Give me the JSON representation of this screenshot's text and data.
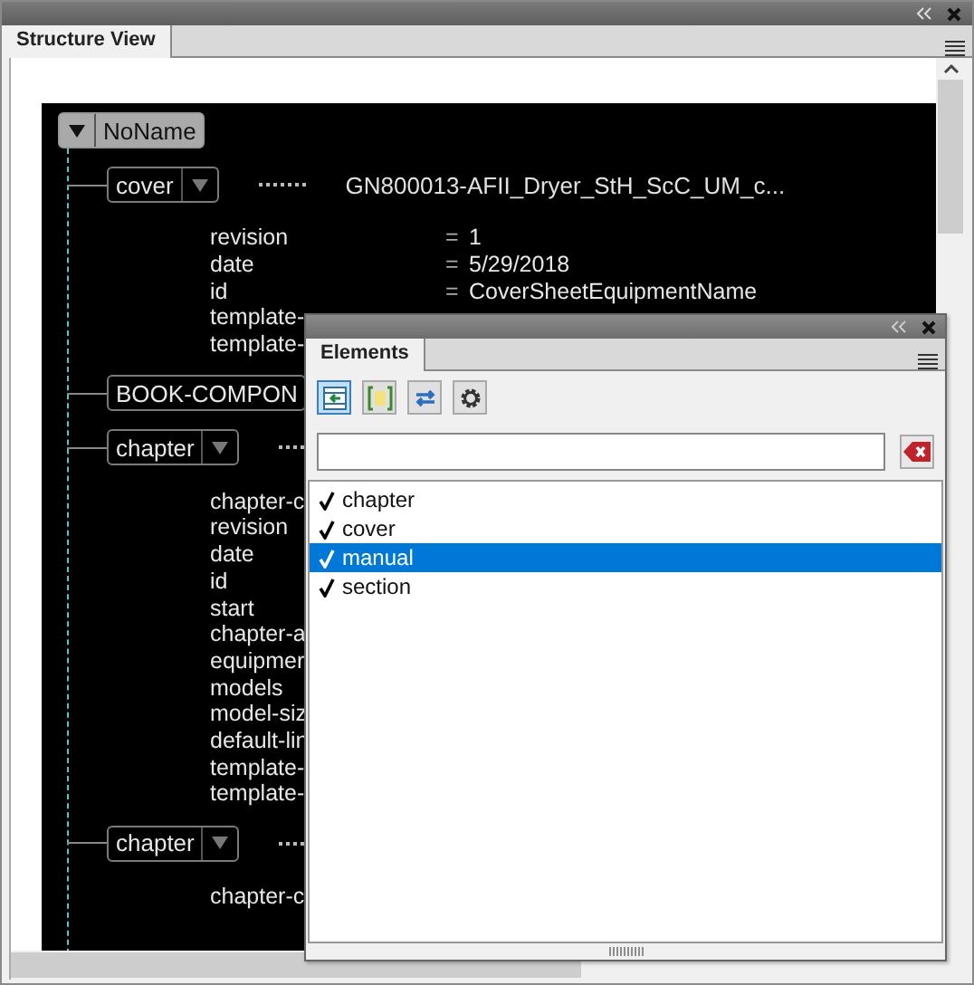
{
  "main_panel": {
    "tab": {
      "label": "Structure View",
      "selected": true
    }
  },
  "tree": {
    "label": "NoName",
    "expanded": true,
    "children": [
      {
        "label": "cover",
        "expanded": true,
        "value": "GN800013-AFII_Dryer_StH_ScC_UM_c...",
        "attributes": [
          {
            "name": "revision",
            "sign": "=",
            "value": "1"
          },
          {
            "name": "date",
            "sign": "=",
            "value": "5/29/2018"
          },
          {
            "name": "id",
            "sign": "=",
            "value": "CoverSheetEquipmentName"
          },
          {
            "name": "template-"
          },
          {
            "name": "template-"
          }
        ]
      },
      {
        "label": "BOOK-COMPON"
      },
      {
        "label": "chapter",
        "expanded": true,
        "attributes": [
          {
            "name": "chapter-c"
          },
          {
            "name": "revision"
          },
          {
            "name": "date"
          },
          {
            "name": "id"
          },
          {
            "name": "start"
          },
          {
            "name": "chapter-a"
          },
          {
            "name": "equipmer"
          },
          {
            "name": "models"
          },
          {
            "name": "model-siz"
          },
          {
            "name": "default-lin"
          },
          {
            "name": "template-"
          },
          {
            "name": "template-"
          }
        ]
      },
      {
        "label": "chapter",
        "expanded": true,
        "attributes": [
          {
            "name": "chapter-c"
          }
        ]
      }
    ]
  },
  "elements_panel": {
    "tab": {
      "label": "Elements",
      "selected": true
    },
    "items": [
      {
        "label": "chapter",
        "checked": true,
        "selected": false
      },
      {
        "label": "cover",
        "checked": true,
        "selected": false
      },
      {
        "label": "manual",
        "checked": true,
        "selected": true
      },
      {
        "label": "section",
        "checked": true,
        "selected": false
      }
    ]
  }
}
